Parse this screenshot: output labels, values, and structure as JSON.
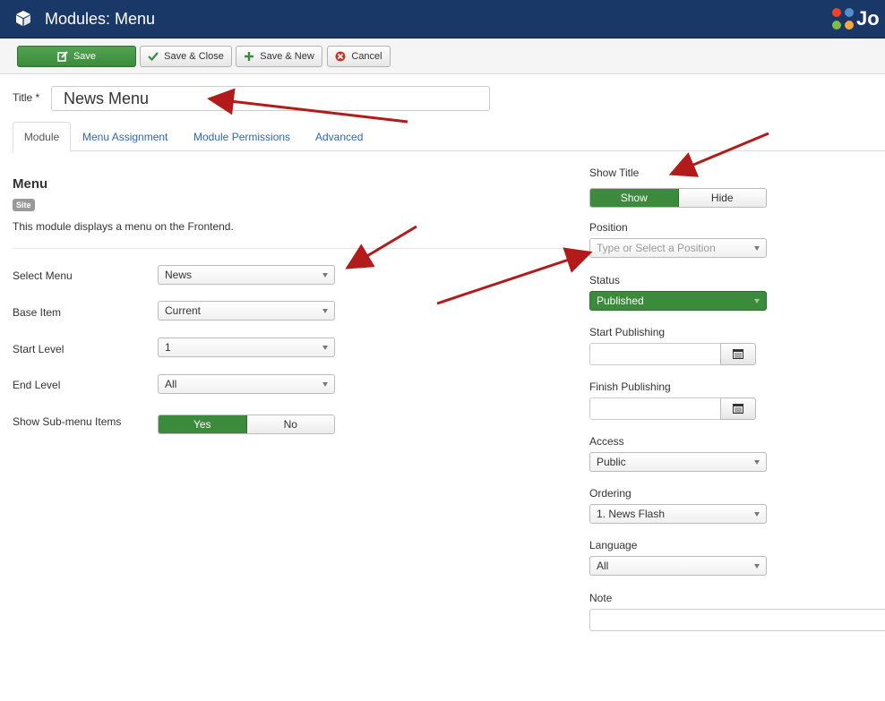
{
  "header": {
    "title": "Modules: Menu",
    "logo_text": "Jo",
    "bg_color": "#1a3867"
  },
  "toolbar": {
    "save_label": "Save",
    "save_close_label": "Save & Close",
    "save_new_label": "Save & New",
    "cancel_label": "Cancel"
  },
  "form": {
    "title_label": "Title *",
    "title_value": "News Menu"
  },
  "tabs": [
    {
      "label": "Module",
      "active": true
    },
    {
      "label": "Menu Assignment",
      "active": false
    },
    {
      "label": "Module Permissions",
      "active": false
    },
    {
      "label": "Advanced",
      "active": false
    }
  ],
  "module": {
    "heading": "Menu",
    "badge": "Site",
    "description": "This module displays a menu on the Frontend."
  },
  "left_fields": {
    "select_menu": {
      "label": "Select Menu",
      "value": "News"
    },
    "base_item": {
      "label": "Base Item",
      "value": "Current"
    },
    "start_level": {
      "label": "Start Level",
      "value": "1"
    },
    "end_level": {
      "label": "End Level",
      "value": "All"
    },
    "show_submenu": {
      "label": "Show Sub-menu Items",
      "yes": "Yes",
      "no": "No",
      "selected": "Yes"
    }
  },
  "right_fields": {
    "show_title": {
      "label": "Show Title",
      "show": "Show",
      "hide": "Hide",
      "selected": "Show"
    },
    "position": {
      "label": "Position",
      "placeholder": "Type or Select a Position"
    },
    "status": {
      "label": "Status",
      "value": "Published"
    },
    "start_publishing": {
      "label": "Start Publishing"
    },
    "finish_publishing": {
      "label": "Finish Publishing"
    },
    "access": {
      "label": "Access",
      "value": "Public"
    },
    "ordering": {
      "label": "Ordering",
      "value": "1. News Flash"
    },
    "language": {
      "label": "Language",
      "value": "All"
    },
    "note": {
      "label": "Note"
    }
  },
  "colors": {
    "accent_green": "#3c8a3c",
    "link_blue": "#2a69b8",
    "annotation_arrow": "#b31b1b"
  }
}
